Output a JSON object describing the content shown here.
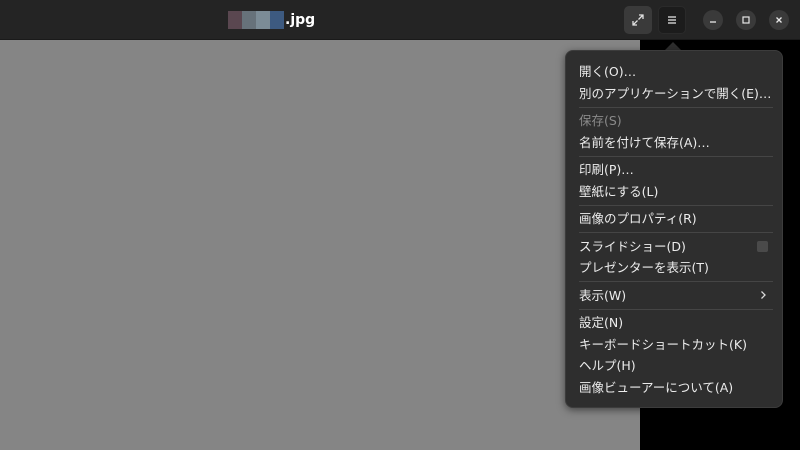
{
  "window": {
    "title_suffix": ".jpg",
    "redaction_colors": [
      "#5a4750",
      "#67727a",
      "#7c8c96",
      "#3d5a80"
    ]
  },
  "header": {
    "fullscreen_icon": "expand-arrows-icon",
    "menu_icon": "hamburger-menu-icon"
  },
  "window_controls": [
    "minimize-icon",
    "maximize-icon",
    "close-icon"
  ],
  "menu": {
    "groups": [
      [
        {
          "label": "開く(O)…"
        },
        {
          "label": "別のアプリケーションで開く(E)…"
        }
      ],
      [
        {
          "label": "保存(S)",
          "disabled": true
        },
        {
          "label": "名前を付けて保存(A)…"
        }
      ],
      [
        {
          "label": "印刷(P)…"
        },
        {
          "label": "壁紙にする(L)"
        }
      ],
      [
        {
          "label": "画像のプロパティ(R)"
        }
      ],
      [
        {
          "label": "スライドショー(D)",
          "checkbox": false
        },
        {
          "label": "プレゼンターを表示(T)"
        }
      ],
      [
        {
          "label": "表示(W)",
          "submenu": true
        }
      ],
      [
        {
          "label": "設定(N)"
        },
        {
          "label": "キーボードショートカット(K)"
        },
        {
          "label": "ヘルプ(H)"
        },
        {
          "label": "画像ビューアーについて(A)"
        }
      ]
    ]
  },
  "colors": {
    "titlebar": "#242424",
    "canvas": "#858585",
    "popover": "#2e2e2e",
    "text": "#ececec",
    "disabled_text": "#8a8a8a"
  }
}
